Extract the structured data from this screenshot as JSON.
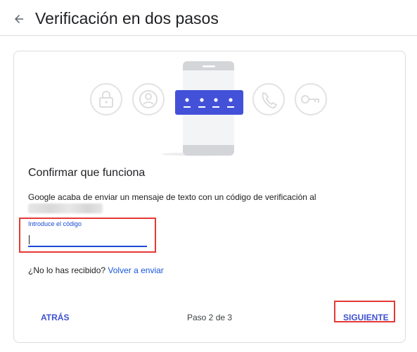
{
  "header": {
    "title": "Verificación en dos pasos",
    "back_icon": "arrow-back-icon"
  },
  "illustration": {
    "icons": [
      "lock-icon",
      "account-icon",
      "phone-icon",
      "key-icon"
    ],
    "code_dots": 4,
    "accent_color": "#4351d9"
  },
  "main": {
    "heading": "Confirmar que funciona",
    "description": "Google acaba de enviar un mensaje de texto con un código de verificación al",
    "code_field": {
      "label": "Introduce el código",
      "value": ""
    },
    "resend": {
      "question": "¿No lo has recibido?",
      "link": "Volver a enviar"
    }
  },
  "footer": {
    "back_label": "ATRÁS",
    "step_text": "Paso 2 de 3",
    "next_label": "SIGUIENTE"
  },
  "colors": {
    "accent": "#3f51d1",
    "highlight": "#e53935",
    "divider": "#dadce0"
  }
}
